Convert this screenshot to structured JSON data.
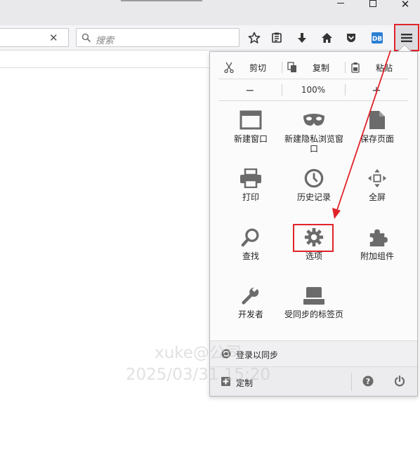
{
  "window": {
    "minimize_icon": "minimize-icon",
    "maximize_icon": "maximize-icon",
    "close_glyph": "✕"
  },
  "navbar": {
    "url_clear_glyph": "✕",
    "search_placeholder": "搜索",
    "toolbar_icons": [
      "bookmark-star-icon",
      "reader-list-icon",
      "download-icon",
      "home-icon",
      "pocket-icon",
      "extension-icon",
      "hamburger-menu-icon"
    ]
  },
  "panel": {
    "edit": {
      "cut": "剪切",
      "copy": "复制",
      "paste": "粘贴"
    },
    "zoom": {
      "minus": "−",
      "level": "100%",
      "plus": "+"
    },
    "items": [
      {
        "label": "新建窗口",
        "icon": "new-window-icon"
      },
      {
        "label": "新建隐私浏览窗口",
        "icon": "private-mask-icon"
      },
      {
        "label": "保存页面",
        "icon": "save-page-icon"
      },
      {
        "label": "打印",
        "icon": "print-icon"
      },
      {
        "label": "历史记录",
        "icon": "history-clock-icon"
      },
      {
        "label": "全屏",
        "icon": "fullscreen-icon"
      },
      {
        "label": "查找",
        "icon": "find-magnifier-icon"
      },
      {
        "label": "选项",
        "icon": "options-gear-icon"
      },
      {
        "label": "附加组件",
        "icon": "addons-puzzle-icon"
      },
      {
        "label": "开发者",
        "icon": "developer-wrench-icon"
      },
      {
        "label": "受同步的标签页",
        "icon": "synced-tabs-icon"
      }
    ],
    "sync_label": "登录以同步",
    "customize_label": "定制"
  },
  "watermark": {
    "line1": "xuke@公司",
    "line2": "2025/03/31 15:20"
  },
  "colors": {
    "highlight": "#e0232a",
    "icon_gray": "#6b6b6b",
    "panel_bg": "#fbfbfb"
  }
}
